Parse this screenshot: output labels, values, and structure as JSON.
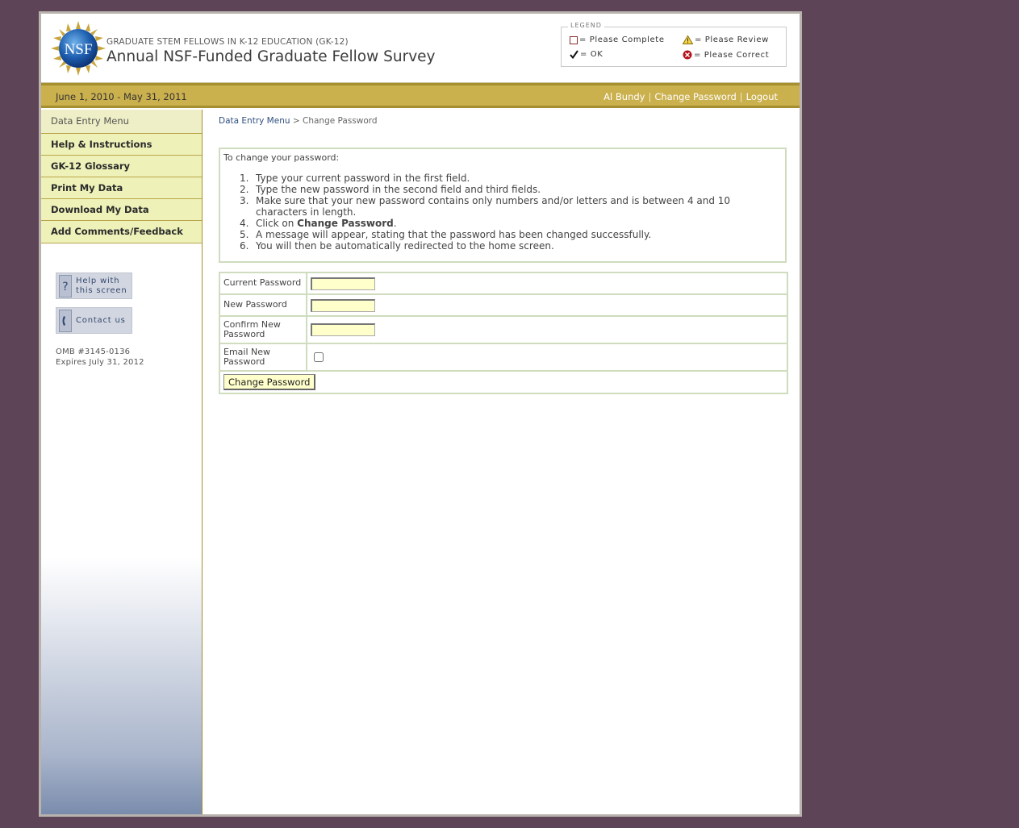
{
  "header": {
    "subtitle": "GRADUATE STEM FELLOWS IN K-12 EDUCATION (GK-12)",
    "title": "Annual NSF-Funded Graduate Fellow Survey",
    "logo_text": "NSF"
  },
  "legend": {
    "caption": "LEGEND",
    "please_complete": "= Please Complete",
    "please_review": "= Please Review",
    "ok": "= OK",
    "please_correct": "= Please Correct"
  },
  "datebar": {
    "date_range": "June 1, 2010 - May 31, 2011",
    "user_name": "Al Bundy",
    "change_password": "Change Password",
    "logout": "Logout",
    "separator": "|"
  },
  "sidebar": {
    "menu_header": "Data Entry Menu",
    "items": [
      {
        "label": "Help & Instructions"
      },
      {
        "label": "GK-12 Glossary"
      },
      {
        "label": "Print My Data"
      },
      {
        "label": "Download My Data"
      },
      {
        "label": "Add Comments/Feedback"
      }
    ],
    "help_button_line1": "Help with",
    "help_button_line2": "this screen",
    "contact_button": "Contact us",
    "omb_line1": "OMB #3145-0136",
    "omb_line2": "Expires July 31, 2012"
  },
  "breadcrumb": {
    "link": "Data Entry Menu",
    "separator": ">",
    "current": "Change Password"
  },
  "instructions": {
    "intro": "To change your password:",
    "steps": [
      {
        "num": "1.",
        "text": "Type your current password in the first field."
      },
      {
        "num": "2.",
        "text": "Type the new password in the second field and third fields."
      },
      {
        "num": "3.",
        "text": "Make sure that your new password contains only numbers and/or letters and is between 4 and 10 characters in length."
      },
      {
        "num": "4.",
        "pre": "Click on ",
        "bold": "Change Password",
        "post": "."
      },
      {
        "num": "5.",
        "text": "A message will appear, stating that the password has been changed successfully."
      },
      {
        "num": "6.",
        "text": "You will then be automatically redirected to the home screen."
      }
    ]
  },
  "form": {
    "current_password_label": "Current Password",
    "current_password_value": "",
    "new_password_label": "New Password",
    "new_password_value": "",
    "confirm_password_label": "Confirm New Password",
    "confirm_password_value": "",
    "email_label": "Email New Password",
    "email_checked": false,
    "submit_label": "Change Password"
  }
}
